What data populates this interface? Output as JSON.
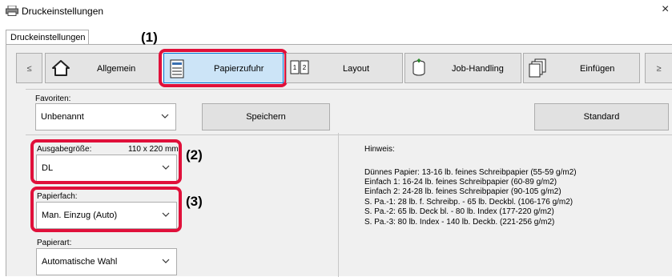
{
  "window": {
    "title": "Druckeinstellungen",
    "close_glyph": "×"
  },
  "tabs": [
    {
      "label": "Druckeinstellungen"
    }
  ],
  "callouts": {
    "c1": "(1)",
    "c2": "(2)",
    "c3": "(3)"
  },
  "nav": {
    "prev": "≤",
    "next": "≥",
    "items": [
      {
        "label": "Allgemein",
        "icon": "home-icon"
      },
      {
        "label": "Papierzufuhr",
        "icon": "paper-tray-icon",
        "selected": true
      },
      {
        "label": "Layout",
        "icon": "layout-pages-icon"
      },
      {
        "label": "Job-Handling",
        "icon": "job-stack-icon"
      },
      {
        "label": "Einfügen",
        "icon": "insert-pages-icon"
      }
    ]
  },
  "favorites": {
    "label": "Favoriten:",
    "value": "Unbenannt",
    "save_label": "Speichern",
    "default_label": "Standard"
  },
  "paper_size": {
    "label": "Ausgabegröße:",
    "dimensions": "110 x 220 mm",
    "value": "DL"
  },
  "paper_tray": {
    "label": "Papierfach:",
    "value": "Man. Einzug (Auto)"
  },
  "paper_type": {
    "label": "Papierart:",
    "value": "Automatische Wahl"
  },
  "hint": {
    "title": "Hinweis:",
    "lines": [
      "Dünnes Papier: 13-16 lb. feines Schreibpapier (55-59 g/m2)",
      "Einfach 1: 16-24 lb. feines Schreibpapier (60-89 g/m2)",
      "Einfach 2: 24-28 lb. feines Schreibpapier (90-105 g/m2)",
      "S. Pa.-1: 28 lb. f. Schreibp. - 65 lb. Deckbl. (106-176 g/m2)",
      "S. Pa.-2: 65 lb. Deck bl. - 80 lb. Index (177-220 g/m2)",
      "S. Pa.-3: 80 lb. Index - 140 lb. Deckb. (221-256 g/m2)"
    ]
  },
  "colors": {
    "highlight": "#e0103a",
    "panel": "#f0f0f0",
    "selected_button": "#cce4f7"
  }
}
